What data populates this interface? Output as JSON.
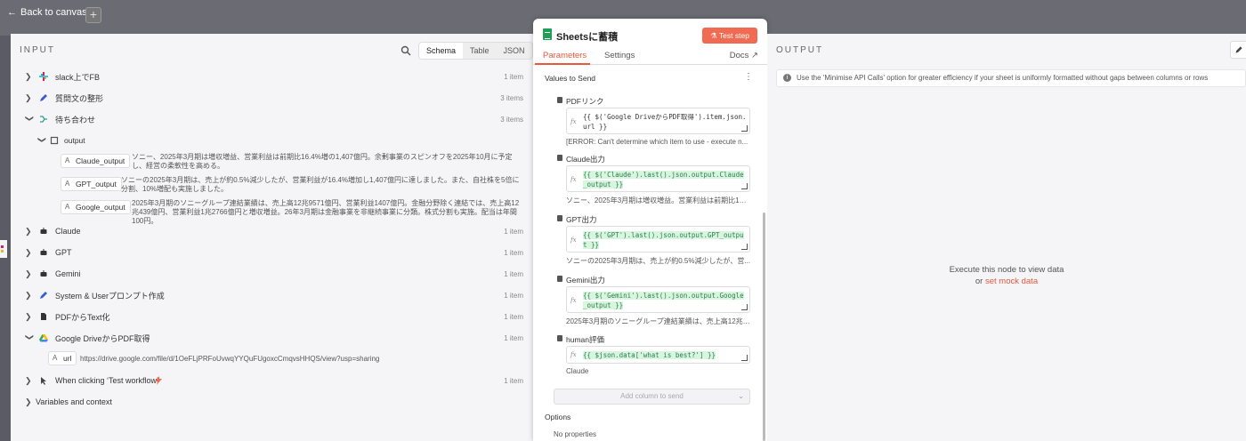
{
  "top": {
    "back_label": "Back to canvas",
    "add_label": "+"
  },
  "input": {
    "title": "INPUT",
    "views": [
      "Schema",
      "Table",
      "JSON"
    ],
    "active_view": "Schema",
    "rows": [
      {
        "label": "slack上でFB",
        "count": "1 item",
        "expanded": false,
        "icon": "slack-icon"
      },
      {
        "label": "質問文の整形",
        "count": "3 items",
        "expanded": false,
        "icon": "pen-icon"
      },
      {
        "label": "待ち合わせ",
        "count": "3 items",
        "expanded": true,
        "icon": "merge-icon"
      }
    ],
    "output_label": "output",
    "fields": [
      {
        "key": "Claude_output",
        "value": "ソニー、2025年3月期は増収増益、営業利益は前期比16.4%増の1,407億円。余剰事業のスピンオフを2025年10月に予定し、経営の柔軟性を高める。"
      },
      {
        "key": "GPT_output",
        "value": "ソニーの2025年3月期は、売上が約0.5%減少したが、営業利益が16.4%増加し1,407億円に達しました。また、自社株を5倍に分割、10%増配も実施しました。"
      },
      {
        "key": "Google_output",
        "value": "2025年3月期のソニーグループ連結業績は、売上高12兆9571億円、営業利益1407億円。金融分野除く連結では、売上高12兆439億円、営業利益1兆2766億円と増収増益。26年3月期は金融事業を非継続事業に分類。株式分割も実施。配当は年間100円。"
      }
    ],
    "rows2": [
      {
        "label": "Claude",
        "count": "1 item",
        "icon": "bot-icon"
      },
      {
        "label": "GPT",
        "count": "1 item",
        "icon": "bot-icon"
      },
      {
        "label": "Gemini",
        "count": "1 item",
        "icon": "bot-icon"
      },
      {
        "label": "System & Userプロンプト作成",
        "count": "1 item",
        "icon": "pen-icon"
      },
      {
        "label": "PDFからText化",
        "count": "1 item",
        "icon": "file-icon"
      },
      {
        "label": "Google DriveからPDF取得",
        "count": "1 item",
        "icon": "drive-icon"
      }
    ],
    "url_field": {
      "key": "url",
      "value": "https://drive.google.com/file/d/1OeFLjPRFoUvwqYYQuFUgoxcCmqvsHHQS/view?usp=sharing"
    },
    "trigger": {
      "label": "When clicking ‘Test workflow’",
      "count": "1 item"
    },
    "variables_label": "Variables and context"
  },
  "node": {
    "title": "Sheetsに蓄積",
    "test_label": "Test step",
    "tabs": [
      "Parameters",
      "Settings"
    ],
    "docs_label": "Docs",
    "values_label": "Values to Send",
    "fields": [
      {
        "name": "PDFリンク",
        "expr": "{{ $('Google DriveからPDF取得').item.json.url }}",
        "result": "[ERROR: Can't determine which item to use - execute n...",
        "green": false
      },
      {
        "name": "Claude出力",
        "expr": "{{ $('Claude').last().json.output.Claude_output }}",
        "result": "ソニー、2025年3月期は増収増益。営業利益は前期比16.4...",
        "green": true
      },
      {
        "name": "GPT出力",
        "expr": "{{ $('GPT').last().json.output.GPT_output }}",
        "result": "ソニーの2025年3月期は、売上が約0.5%減少したが、営...",
        "green": true
      },
      {
        "name": "Gemini出力",
        "expr": "{{ $('Gemini').last().json.output.Google_output }}",
        "result": "2025年3月期のソニーグループ連結業績は、売上高12兆9...",
        "green": true
      },
      {
        "name": "human評価",
        "expr": "{{ $json.data['what is best?'] }}",
        "result": "Claude",
        "green": true
      }
    ],
    "add_column_label": "Add column to send",
    "options_label": "Options",
    "no_properties": "No properties"
  },
  "output": {
    "title": "OUTPUT",
    "notice": "Use the 'Minimise API Calls' option for greater efficiency if your sheet is uniformly formatted without gaps between columns or rows",
    "exec_text": "Execute this node to view data",
    "or_text": "or",
    "mock_link": "set mock data"
  }
}
